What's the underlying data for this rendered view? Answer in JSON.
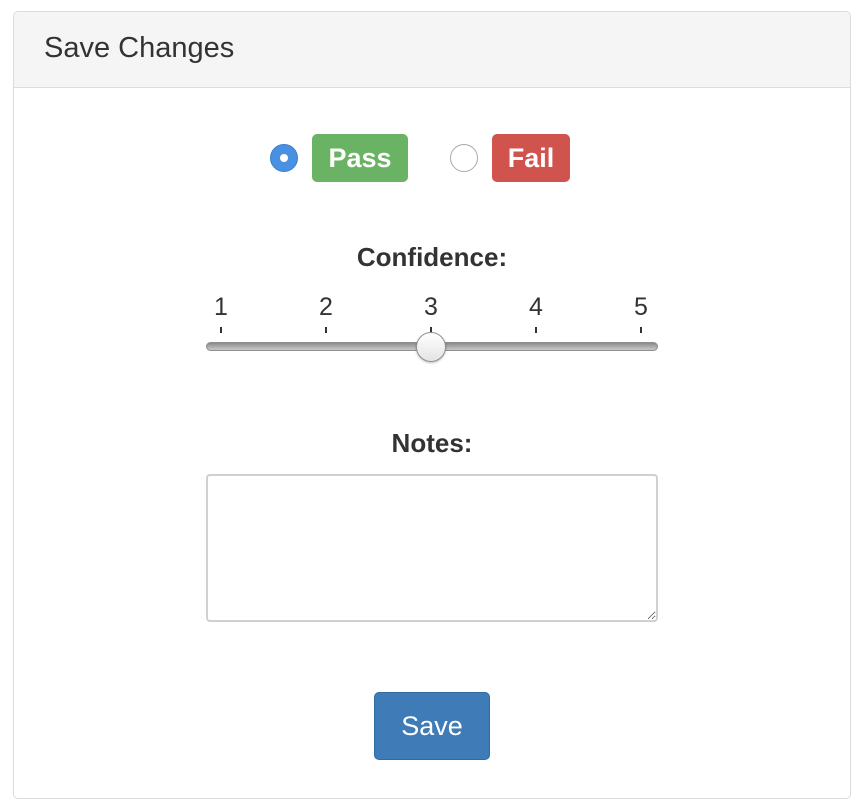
{
  "panel": {
    "title": "Save Changes"
  },
  "result": {
    "options": [
      {
        "label": "Pass",
        "checked": true,
        "color": "#6bb364"
      },
      {
        "label": "Fail",
        "checked": false,
        "color": "#d0534d"
      }
    ]
  },
  "confidence": {
    "label": "Confidence:",
    "ticks": [
      "1",
      "2",
      "3",
      "4",
      "5"
    ],
    "value": 3,
    "min": 1,
    "max": 5
  },
  "notes": {
    "label": "Notes:",
    "value": "",
    "placeholder": ""
  },
  "actions": {
    "save_label": "Save"
  },
  "colors": {
    "radio_checked": "#4a90e2",
    "primary_button": "#3f7bb6"
  }
}
